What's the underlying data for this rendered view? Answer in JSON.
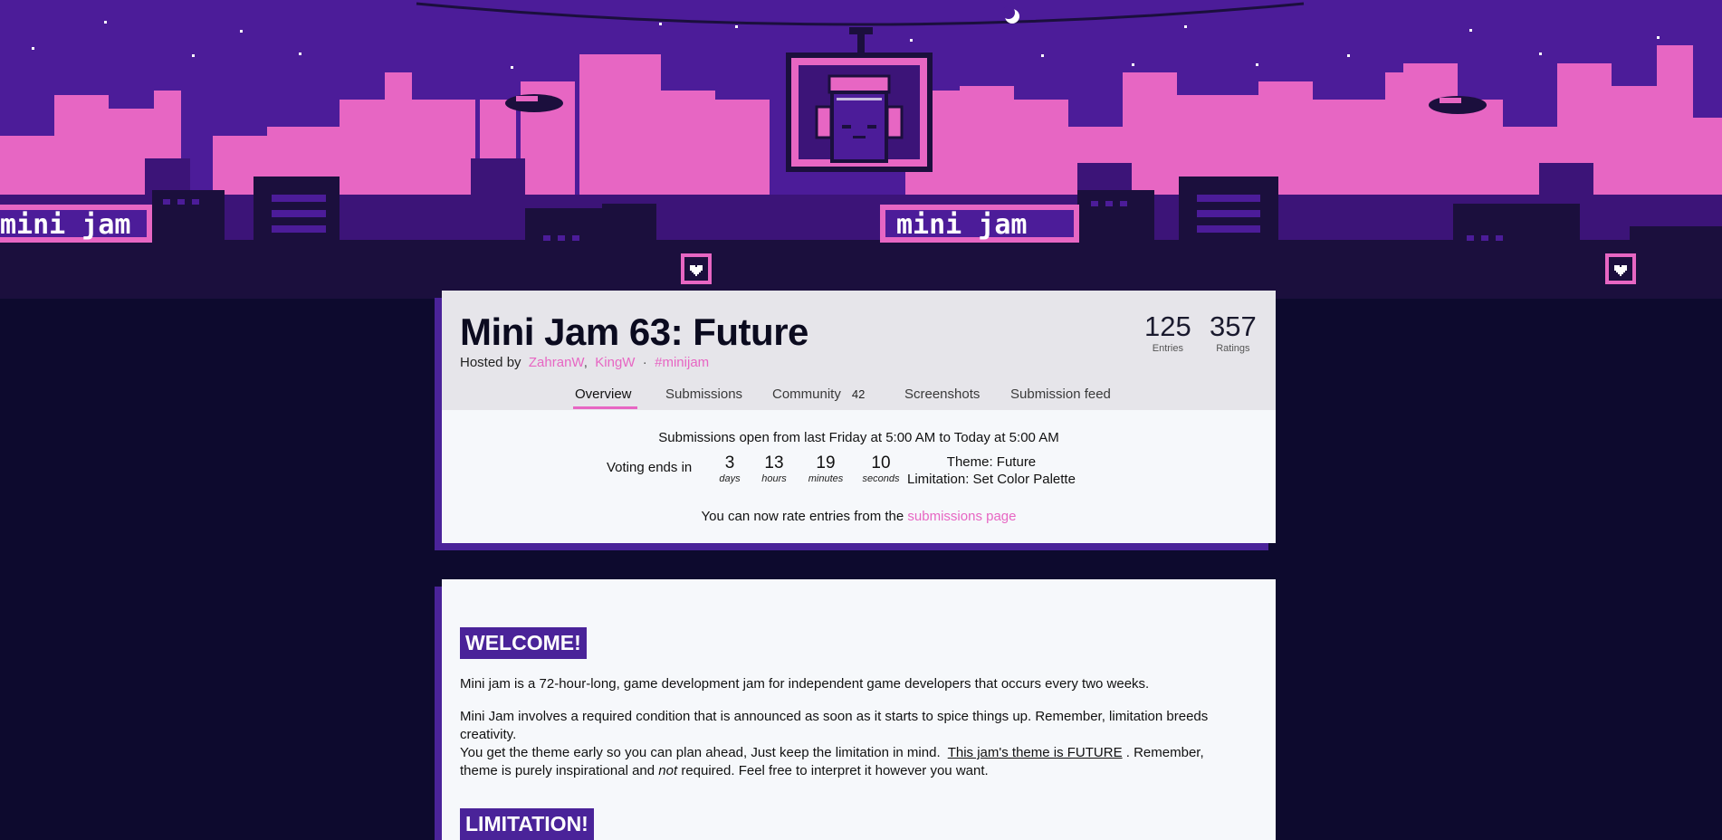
{
  "colors": {
    "page_bg": "#0d0a2e",
    "sky": "#4c1c99",
    "pink": "#e766c3",
    "accent_purple": "#4a2399",
    "card_header_bg": "#e6e5ea",
    "card_bg": "#f6f8fb"
  },
  "banner": {
    "sign_text": "mini jam",
    "icons": [
      "robot-headphones-icon",
      "heart-icon",
      "blimp-icon",
      "star-icon",
      "moon-icon"
    ]
  },
  "jam": {
    "title": "Mini Jam 63: Future",
    "hosted_by_label": "Hosted by",
    "hosts": [
      "ZahranW",
      "KingW"
    ],
    "host_sep": ",",
    "hashtag": "#minijam",
    "stats": [
      {
        "value": "125",
        "label": "Entries"
      },
      {
        "value": "357",
        "label": "Ratings"
      }
    ]
  },
  "tabs": [
    {
      "label": "Overview",
      "active": true
    },
    {
      "label": "Submissions"
    },
    {
      "label": "Community",
      "count": "42"
    },
    {
      "label": "Screenshots"
    },
    {
      "label": "Submission feed"
    }
  ],
  "status": {
    "open_line": "Submissions open from last Friday at 5:00 AM to Today at 5:00 AM",
    "voting_label": "Voting ends in",
    "countdown": [
      {
        "value": "3",
        "unit": "days"
      },
      {
        "value": "13",
        "unit": "hours"
      },
      {
        "value": "19",
        "unit": "minutes"
      },
      {
        "value": "10",
        "unit": "seconds"
      }
    ],
    "theme": "Theme: Future",
    "limitation": "Limitation: Set Color Palette",
    "rate_prefix": "You can now rate entries from the",
    "rate_link": "submissions page"
  },
  "content": {
    "welcome_title": "WELCOME!",
    "p1": "Mini jam is a 72-hour-long, game development jam for independent game developers that occurs every two weeks.",
    "p2": "Mini Jam involves a required condition that is announced as soon as it starts to spice things up. Remember, limitation breeds creativity.",
    "p3_a": "You get the theme early so you can plan ahead, Just keep the limitation in mind.",
    "p3_link": "This jam's theme is FUTURE",
    "p3_b": ". Remember,",
    "p4_a": "theme is purely inspirational and",
    "p4_em": "not",
    "p4_b": "required. Feel free to interpret it however you want.",
    "limitation_title": "LIMITATION!"
  }
}
